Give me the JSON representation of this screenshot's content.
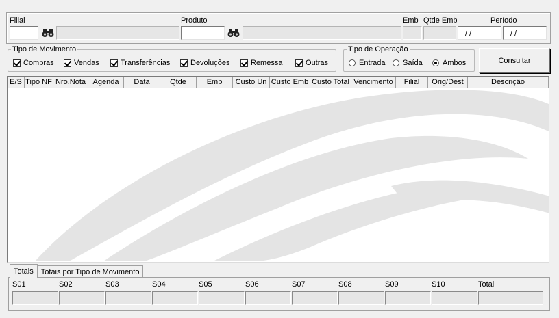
{
  "filter": {
    "filial_label": "Filial",
    "produto_label": "Produto",
    "emb_label": "Emb",
    "qtde_emb_label": "Qtde Emb",
    "periodo_label": "Período",
    "periodo_de": " / /",
    "periodo_ate": " / /"
  },
  "tipo_movimento": {
    "legend": "Tipo de Movimento",
    "items": [
      "Compras",
      "Vendas",
      "Transferências",
      "Devoluções",
      "Remessa",
      "Outras"
    ]
  },
  "tipo_operacao": {
    "legend": "Tipo de Operação",
    "options": [
      "Entrada",
      "Saída",
      "Ambos"
    ],
    "selected": "Ambos"
  },
  "consultar_label": "Consultar",
  "grid": {
    "columns": [
      "E/S",
      "Tipo NF",
      "Nro.Nota",
      "Agenda",
      "Data",
      "Qtde",
      "Emb",
      "Custo Un",
      "Custo Emb",
      "Custo Total",
      "Vencimento",
      "Filial",
      "Orig/Dest",
      "Descrição"
    ]
  },
  "tabs": [
    "Totais",
    "Totais por Tipo de Movimento"
  ],
  "totals": {
    "labels": [
      "S01",
      "S02",
      "S03",
      "S04",
      "S05",
      "S06",
      "S07",
      "S08",
      "S09",
      "S10",
      "Total"
    ]
  },
  "icons": {
    "search": "binoculars-icon"
  }
}
